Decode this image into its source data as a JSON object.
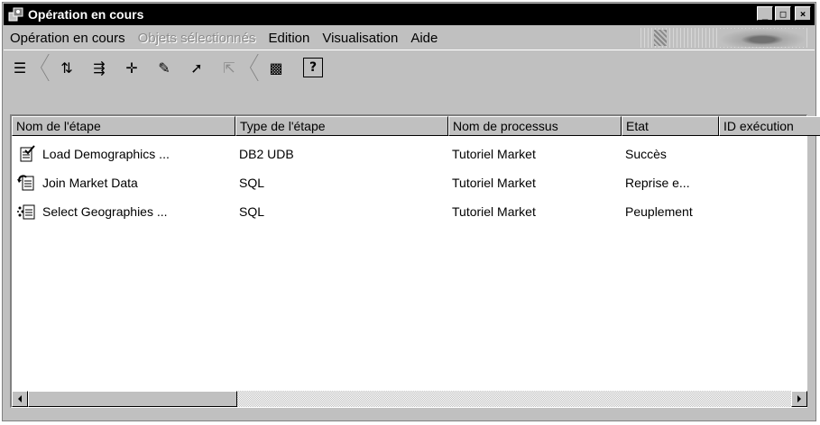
{
  "window": {
    "title": "Opération en cours",
    "buttons": {
      "minimize": "_",
      "maximize": "□",
      "close": "×"
    }
  },
  "menu": [
    {
      "label": "Opération en cours",
      "disabled": false
    },
    {
      "label": "Objets sélectionnés",
      "disabled": true
    },
    {
      "label": "Edition",
      "disabled": false
    },
    {
      "label": "Visualisation",
      "disabled": false
    },
    {
      "label": "Aide",
      "disabled": false
    }
  ],
  "toolbar": {
    "details_glyph": "☰",
    "sort_glyph": "⇅",
    "filter_glyph": "⇶",
    "move_glyph": "✛",
    "promote_glyph": "✎",
    "select_glyph": "➚",
    "deselect_glyph": "⇱",
    "log_glyph": "▩",
    "help_glyph": "?"
  },
  "table": {
    "columns": [
      "Nom de l'étape",
      "Type de l'étape",
      "Nom de processus",
      "Etat",
      "ID exécution"
    ],
    "rows": [
      {
        "icon": "step-check-icon",
        "name": "Load Demographics ...",
        "type": "DB2 UDB",
        "process": "Tutoriel Market",
        "state": "Succès",
        "run_id": ""
      },
      {
        "icon": "step-retry-icon",
        "name": "Join Market Data",
        "type": "SQL",
        "process": "Tutoriel Market",
        "state": "Reprise e...",
        "run_id": ""
      },
      {
        "icon": "step-populate-icon",
        "name": "Select Geographies ...",
        "type": "SQL",
        "process": "Tutoriel Market",
        "state": "Peuplement",
        "run_id": ""
      }
    ]
  },
  "colors": {
    "chrome": "#c0c0c0",
    "titlebar": "#000000",
    "list_bg": "#ffffff",
    "disabled_text": "#8c8c8c"
  }
}
